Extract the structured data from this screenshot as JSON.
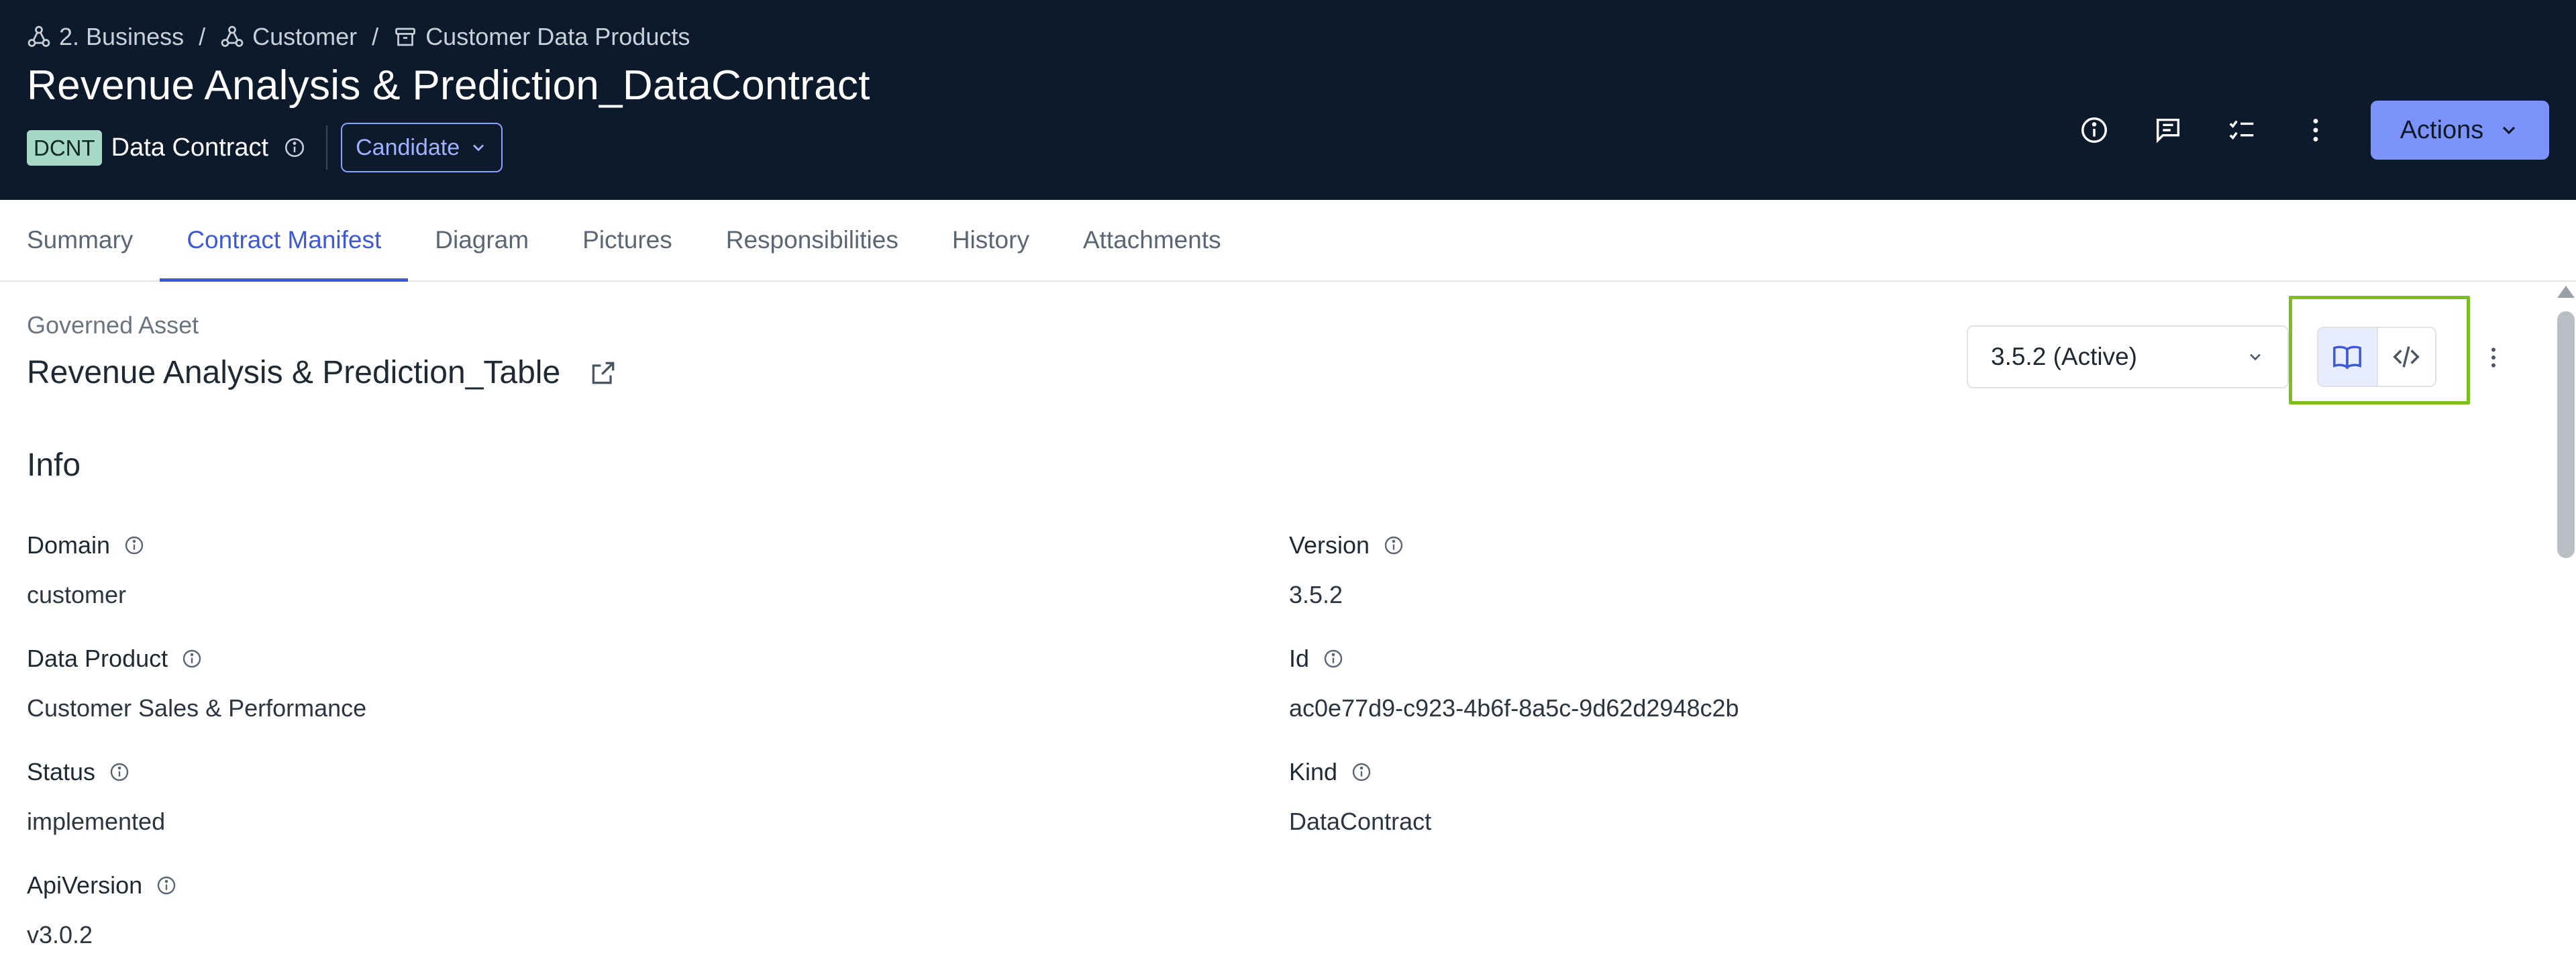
{
  "breadcrumb": [
    {
      "label": "2. Business",
      "icon": "domain-icon"
    },
    {
      "label": "Customer",
      "icon": "domain-icon"
    },
    {
      "label": "Customer Data Products",
      "icon": "archive-icon"
    }
  ],
  "header": {
    "title": "Revenue Analysis & Prediction_DataContract",
    "type_badge": "DCNT",
    "type_label": "Data Contract",
    "status": "Candidate",
    "actions_label": "Actions"
  },
  "tabs": [
    {
      "label": "Summary",
      "active": false
    },
    {
      "label": "Contract Manifest",
      "active": true
    },
    {
      "label": "Diagram",
      "active": false
    },
    {
      "label": "Pictures",
      "active": false
    },
    {
      "label": "Responsibilities",
      "active": false
    },
    {
      "label": "History",
      "active": false
    },
    {
      "label": "Attachments",
      "active": false
    }
  ],
  "governed": {
    "label": "Governed Asset",
    "title": "Revenue Analysis & Prediction_Table"
  },
  "version_select": {
    "value": "3.5.2 (Active)"
  },
  "info": {
    "title": "Info",
    "fields": {
      "domain": {
        "label": "Domain",
        "value": "customer"
      },
      "version": {
        "label": "Version",
        "value": "3.5.2"
      },
      "data_product": {
        "label": "Data Product",
        "value": "Customer Sales & Performance"
      },
      "id": {
        "label": "Id",
        "value": "ac0e77d9-c923-4b6f-8a5c-9d62d2948c2b"
      },
      "status": {
        "label": "Status",
        "value": "implemented"
      },
      "kind": {
        "label": "Kind",
        "value": "DataContract"
      },
      "api_version": {
        "label": "ApiVersion",
        "value": "v3.0.2"
      }
    }
  },
  "colors": {
    "header_bg": "#0d1a2b",
    "accent": "#3b59d9",
    "actions_bg": "#7b93fb",
    "badge_bg": "#a7d7c5",
    "highlight": "#7dbe1f"
  }
}
